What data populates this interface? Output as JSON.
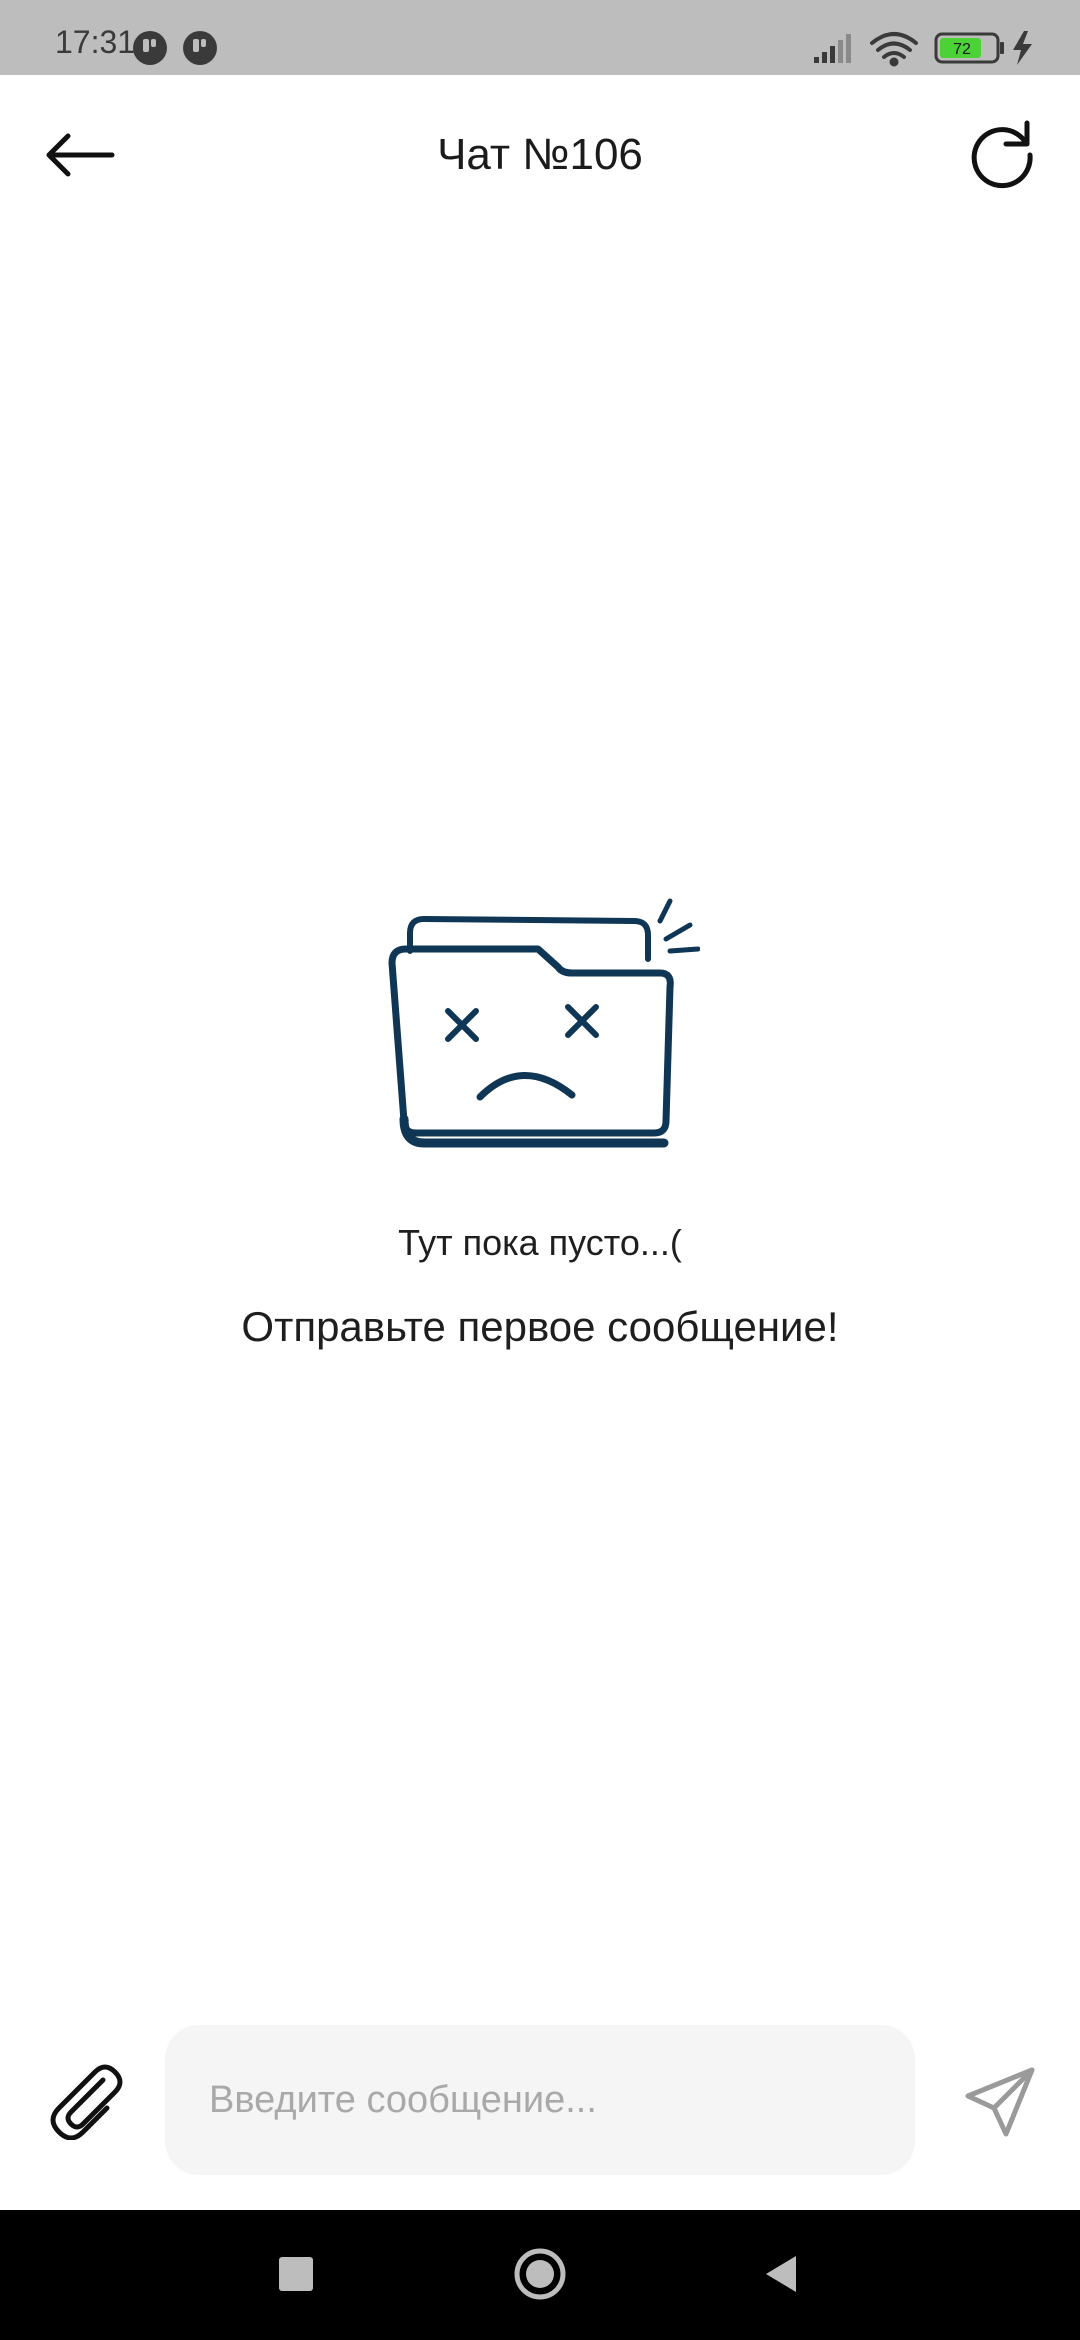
{
  "status_bar": {
    "time": "17:31",
    "battery_level": "72",
    "notification_icons": [
      "app-notification-icon",
      "app-notification-icon"
    ],
    "icons": [
      "signal-icon",
      "wifi-icon",
      "battery-icon",
      "charging-icon"
    ]
  },
  "header": {
    "title": "Чат №106",
    "back_icon": "arrow-left-icon",
    "refresh_icon": "refresh-icon"
  },
  "empty_state": {
    "illustration": "sad-folder-illustration",
    "title": "Тут пока пусто...(",
    "subtitle": "Отправьте первое сообщение!"
  },
  "composer": {
    "attach_icon": "paperclip-icon",
    "placeholder": "Введите сообщение...",
    "value": "",
    "send_icon": "paper-plane-icon"
  },
  "nav_bar": {
    "icons": [
      "recents-icon",
      "home-icon",
      "back-icon"
    ]
  },
  "colors": {
    "status_bar_bg": "#bdbdbd",
    "illustration": "#0f3654",
    "input_bg": "#f5f5f5",
    "battery_fill": "#4cd137",
    "nav_bar_bg": "#000000"
  }
}
